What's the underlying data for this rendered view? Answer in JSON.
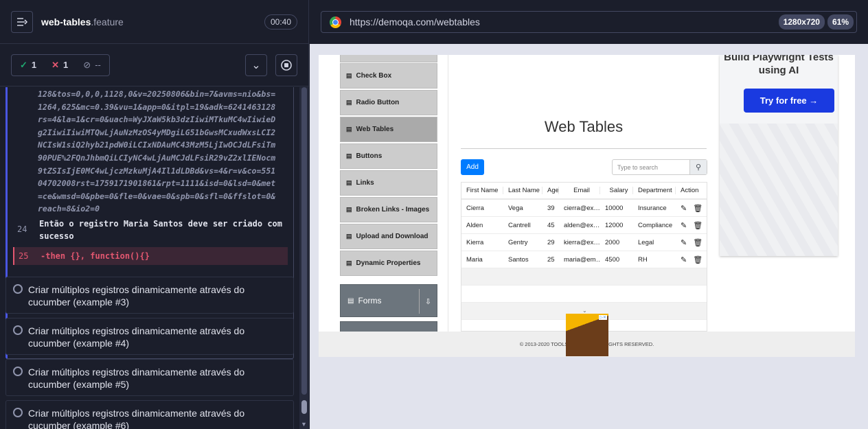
{
  "runner": {
    "file_name": "web-tables",
    "file_ext": ".feature",
    "timer": "00:40",
    "stats": {
      "passed": "1",
      "failed": "1",
      "pending": "--"
    },
    "code_lines": [
      "128&tos=0,0,0,1128,0&v=20250806&bin=7&avms=nio&bs=",
      "1264,625&mc=0.39&vu=1&app=0&itpl=19&adk=6241463128",
      "rs=4&la=1&cr=0&uach=WyJXaW5kb3dzIiwiMTkuMC4wIiwieD",
      "g2IiwiIiwiMTQwLjAuNzMzOS4yMDgiLG51bGwsMCxudWxsLCI2",
      "NCIsW1siQ2hyb21pdW0iLCIxNDAuMC43MzM5LjIwOCJdLFsiTm",
      "90PUE%2FQnJhbmQiLCIyNC4wLjAuMCJdLFsiR29vZ2xlIENocm",
      "9tZSIsIjE0MC4wLjczMzkuMjA4Il1dLDBd&vs=4&r=v&co=551",
      "04702008rst=1759171901861&rpt=1111&isd=0&lsd=0&met",
      "=ce&wmsd=0&pbe=0&fle=0&vae=0&spb=0&sfl=0&ffslot=0&",
      "reach=8&io2=0"
    ],
    "step24": {
      "num": "24",
      "text": "Então   o registro Maria Santos deve ser criado com sucesso"
    },
    "step25": {
      "num": "25",
      "text": "-then  {}, function(){}"
    },
    "tests": [
      "Criar múltiplos registros dinamicamente através do cucumber (example #3)",
      "Criar múltiplos registros dinamicamente através do cucumber (example #4)",
      "Criar múltiplos registros dinamicamente através do cucumber (example #5)",
      "Criar múltiplos registros dinamicamente através do cucumber (example #6)"
    ]
  },
  "aut": {
    "url": "https://demoqa.com/webtables",
    "viewport": "1280x720",
    "scale": "61%",
    "nav": [
      "Check Box",
      "Radio Button",
      "Web Tables",
      "Buttons",
      "Links",
      "Broken Links - Images",
      "Upload and Download",
      "Dynamic Properties"
    ],
    "nav_group": "Forms",
    "heading": "Web Tables",
    "add_label": "Add",
    "search_placeholder": "Type to search",
    "table": {
      "headers": [
        "First Name",
        "Last Name",
        "Age",
        "Email",
        "Salary",
        "Department",
        "Action"
      ],
      "rows": [
        [
          "Cierra",
          "Vega",
          "39",
          "cierra@ex…",
          "10000",
          "Insurance"
        ],
        [
          "Alden",
          "Cantrell",
          "45",
          "alden@ex…",
          "12000",
          "Compliance"
        ],
        [
          "Kierra",
          "Gentry",
          "29",
          "kierra@ex…",
          "2000",
          "Legal"
        ],
        [
          "Maria",
          "Santos",
          "25",
          "maria@em…",
          "4500",
          "RH"
        ]
      ]
    },
    "ad": {
      "title": "Build Playwright Tests using AI",
      "button": "Try for free →"
    },
    "footer": "© 2013-2020 TOOLSQA.COM | ALL RIGHTS RESERVED."
  }
}
